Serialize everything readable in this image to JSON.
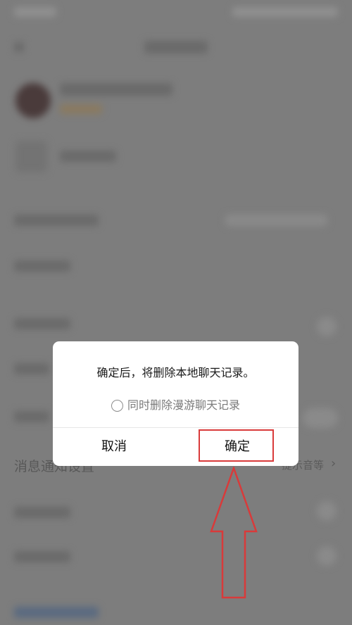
{
  "dialog": {
    "message": "确定后，将删除本地聊天记录。",
    "checkbox_label": "同时删除漫游聊天记录",
    "cancel_label": "取消",
    "confirm_label": "确定"
  },
  "background": {
    "row_labels": [
      "消息通知设置"
    ],
    "right_text": "提示音等"
  },
  "colors": {
    "highlight": "#d93a3a",
    "dim_bg": "#7d7d7d"
  },
  "icons": [
    "radio-circle-icon",
    "arrow-up-icon",
    "chevron-right-icon"
  ]
}
